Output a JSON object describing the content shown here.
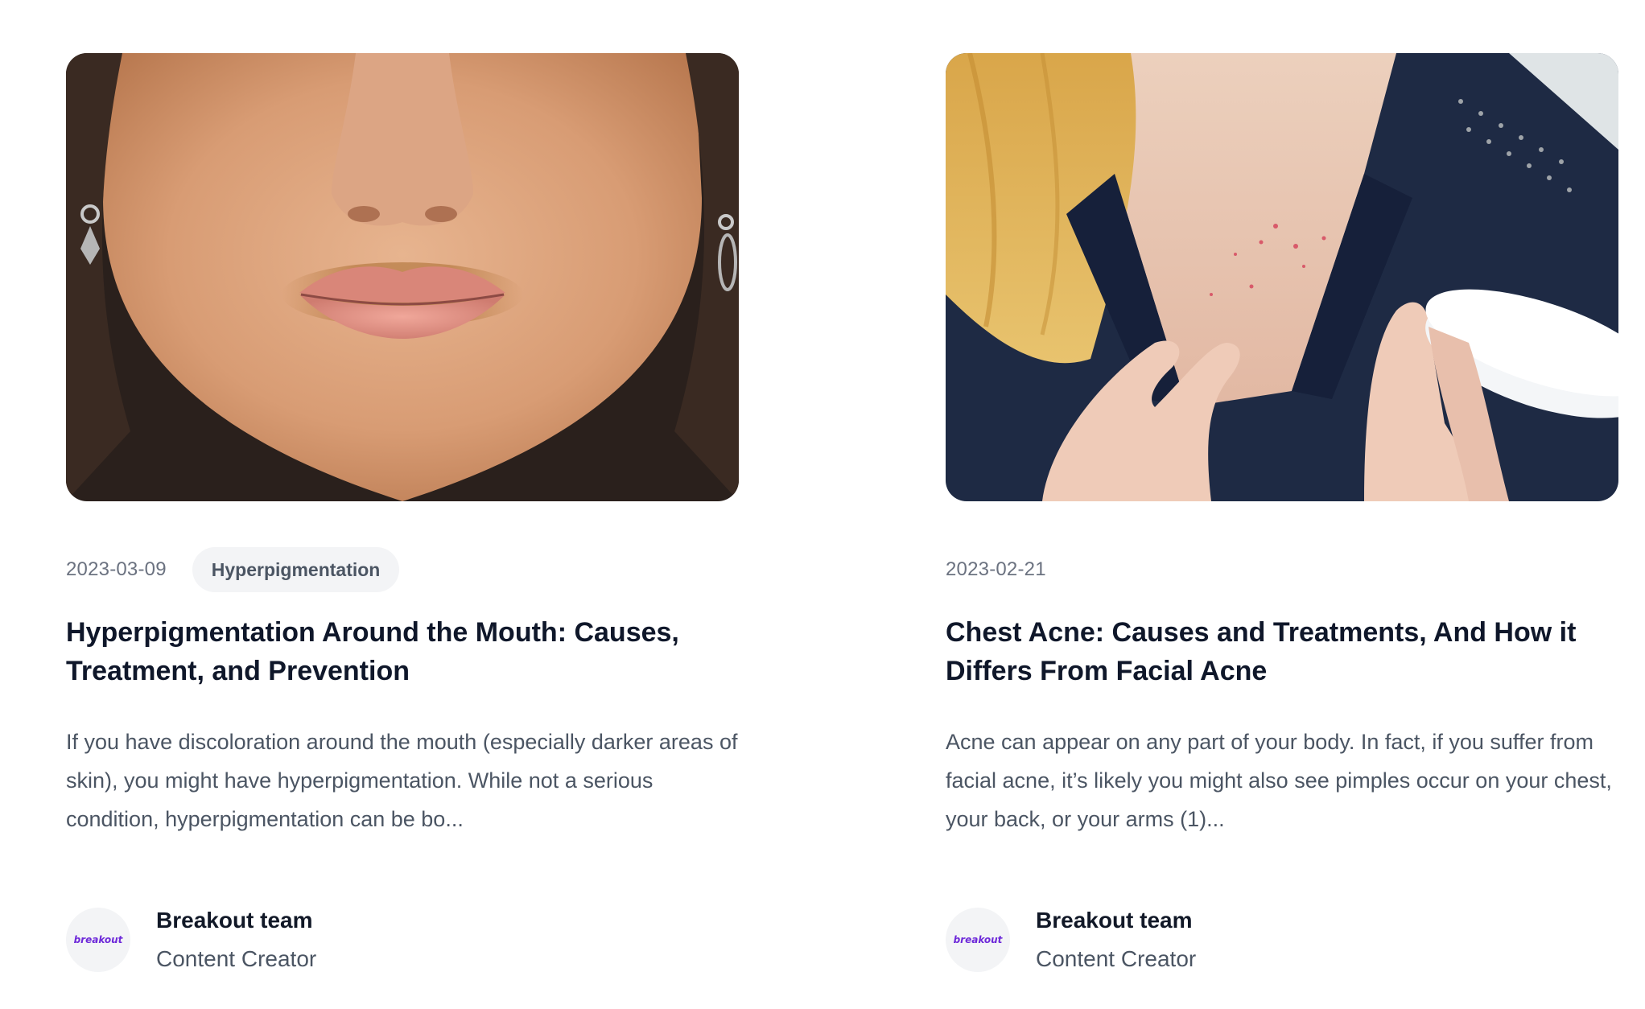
{
  "posts": [
    {
      "image_alt": "Close-up of lower face with darker skin around the mouth",
      "date": "2023-03-09",
      "tag": "Hyperpigmentation",
      "title": "Hyperpigmentation Around the Mouth: Causes, Treatment, and Prevention",
      "excerpt": "If you have discoloration around the mouth (especially darker areas of skin), you might have hyperpigmentation. While not a serious condition, hyperpigmentation can be bo...",
      "author": {
        "avatar_text": "breakout",
        "name": "Breakout team",
        "role": "Content Creator"
      }
    },
    {
      "image_alt": "Woman with chest acne holding a jar of cream",
      "date": "2023-02-21",
      "tag": "",
      "title": "Chest Acne: Causes and Treatments, And How it Differs From Facial Acne",
      "excerpt": "Acne can appear on any part of your body. In fact, if you suffer from facial acne, it’s likely you might also see pimples occur on your chest, your back, or your arms (1)...",
      "author": {
        "avatar_text": "breakout",
        "name": "Breakout team",
        "role": "Content Creator"
      }
    }
  ],
  "colors": {
    "accent_avatar": "#6d28d9",
    "tag_bg": "#f3f4f6",
    "title": "#0f172a",
    "body_text": "#4b5563"
  }
}
